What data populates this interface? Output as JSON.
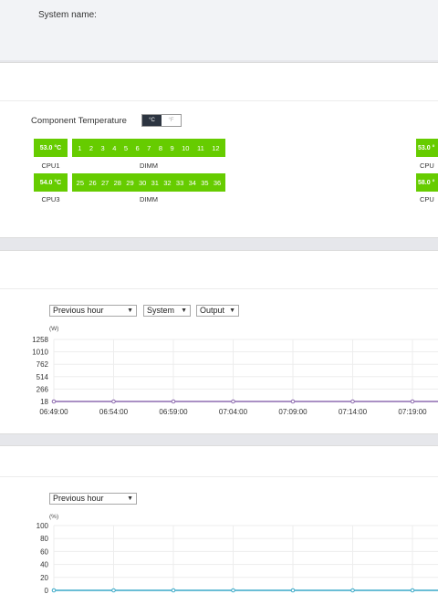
{
  "header": {
    "system_name_label": "System name:"
  },
  "temperature": {
    "title": "Component Temperature",
    "unit_c": "°C",
    "unit_f": "°F",
    "row1": {
      "cpu_value": "53.0 °C",
      "cpu_label": "CPU1",
      "dimm_label": "DIMM",
      "slots": [
        "1",
        "2",
        "3",
        "4",
        "5",
        "6",
        "7",
        "8",
        "9",
        "10",
        "11",
        "12"
      ],
      "right_value": "53.0 °",
      "right_label": "CPU"
    },
    "row2": {
      "cpu_value": "54.0 °C",
      "cpu_label": "CPU3",
      "dimm_label": "DIMM",
      "slots": [
        "25",
        "26",
        "27",
        "28",
        "29",
        "30",
        "31",
        "32",
        "33",
        "34",
        "35",
        "36"
      ],
      "right_value": "58.0 °",
      "right_label": "CPU"
    },
    "status_color": "#66cc00"
  },
  "power": {
    "time_select": "Previous hour",
    "scope_select": "System",
    "type_select": "Output",
    "chart_data": {
      "type": "line",
      "ylabel": "(W)",
      "y_ticks": [
        "1258",
        "1010",
        "762",
        "514",
        "266",
        "18"
      ],
      "x": [
        "06:49:00",
        "06:54:00",
        "06:59:00",
        "07:04:00",
        "07:09:00",
        "07:14:00",
        "07:19:00"
      ],
      "series": [
        {
          "values": [
            18,
            18,
            18,
            18,
            18,
            18,
            18,
            18
          ],
          "color": "#8e6bb0"
        }
      ]
    }
  },
  "utilization": {
    "time_select": "Previous hour",
    "chart_data": {
      "type": "line",
      "ylabel": "(%)",
      "y_ticks": [
        "100",
        "80",
        "60",
        "40",
        "20",
        "0"
      ],
      "series": [
        {
          "values": [
            0,
            0,
            0,
            0,
            0,
            0,
            0,
            0
          ],
          "color": "#3aa9c8"
        }
      ]
    }
  }
}
